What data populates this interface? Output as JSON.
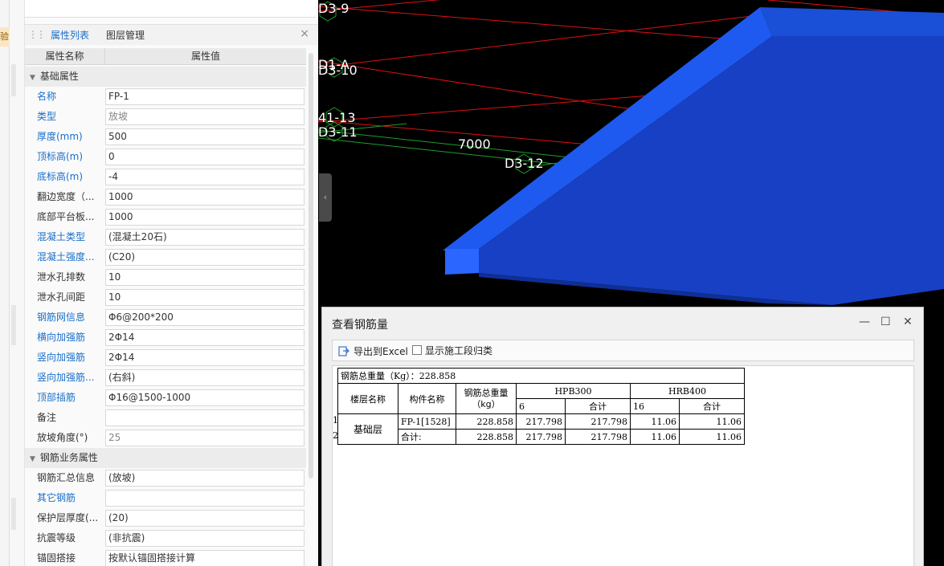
{
  "left_strip": {
    "tag": "验"
  },
  "panel": {
    "tabs": [
      {
        "label": "属性列表",
        "active": true
      },
      {
        "label": "图层管理",
        "active": false
      }
    ],
    "close": "×",
    "columns": {
      "name": "属性名称",
      "value": "属性值"
    },
    "sections": [
      {
        "title": "基础属性",
        "rows": [
          {
            "name": "名称",
            "value": "FP-1"
          },
          {
            "name": "类型",
            "value": "放坡"
          },
          {
            "name": "厚度(mm)",
            "value": "500"
          },
          {
            "name": "顶标高(m)",
            "value": "0"
          },
          {
            "name": "底标高(m)",
            "value": "-4"
          },
          {
            "name": "翻边宽度（...",
            "value": "1000"
          },
          {
            "name": "底部平台板...",
            "value": "1000"
          },
          {
            "name": "混凝土类型",
            "value": "(混凝土20石)"
          },
          {
            "name": "混凝土强度...",
            "value": "(C20)"
          },
          {
            "name": "泄水孔排数",
            "value": "10"
          },
          {
            "name": "泄水孔间距",
            "value": "10"
          },
          {
            "name": "钢筋网信息",
            "value": "Φ6@200*200"
          },
          {
            "name": "横向加强筋",
            "value": "2Φ14"
          },
          {
            "name": "竖向加强筋",
            "value": "2Φ14"
          },
          {
            "name": "竖向加强筋...",
            "value": "(右斜)"
          },
          {
            "name": "顶部插筋",
            "value": "Φ16@1500-1000"
          },
          {
            "name": "备注",
            "value": ""
          },
          {
            "name": "放坡角度(°)",
            "value": "25"
          }
        ]
      },
      {
        "title": "钢筋业务属性",
        "rows": [
          {
            "name": "钢筋汇总信息",
            "value": "(放坡)"
          },
          {
            "name": "其它钢筋",
            "value": ""
          },
          {
            "name": "保护层厚度(...",
            "value": "(20)"
          },
          {
            "name": "抗震等级",
            "value": "(非抗震)"
          },
          {
            "name": "锚固搭接",
            "value": "按默认锚固搭接计算"
          }
        ]
      }
    ]
  },
  "viewport": {
    "labels": [
      "D3-9",
      "D1-A",
      "D3-10",
      "41-13",
      "D3-11",
      "7000",
      "D3-12"
    ],
    "colors": {
      "red_line": "#e01010",
      "green_line": "#1f9e2a",
      "blue_face": "#1a4fd8",
      "blue_top": "#1e5af0"
    }
  },
  "dialog": {
    "title": "查看钢筋量",
    "controls": {
      "minimize": "—",
      "maximize": "☐",
      "close": "✕"
    },
    "toolbar": {
      "export_label": "导出到Excel",
      "checkbox_label": "显示施工段归类"
    },
    "table": {
      "summary": "钢筋总重量（Kg）：228.858",
      "headers": {
        "floor": "楼层名称",
        "component": "构件名称",
        "total_weight_line1": "钢筋总重量",
        "total_weight_line2": "（kg）",
        "group1": "HPB300",
        "group2": "HRB400",
        "g1_col1": "6",
        "g1_col2": "合计",
        "g2_col1": "16",
        "g2_col2": "合计"
      },
      "row_numbers": [
        "1",
        "2"
      ],
      "floor": "基础层",
      "rows": [
        {
          "component": "FP-1[1528]",
          "total": "228.858",
          "hpb_6": "217.798",
          "hpb_sum": "217.798",
          "hrb_16": "11.06",
          "hrb_sum": "11.06"
        },
        {
          "component": "合计:",
          "total": "228.858",
          "hpb_6": "217.798",
          "hpb_sum": "217.798",
          "hrb_16": "11.06",
          "hrb_sum": "11.06"
        }
      ]
    }
  }
}
